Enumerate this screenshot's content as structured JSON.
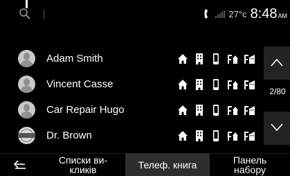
{
  "status": {
    "temperature": "27°c",
    "time": "8:48",
    "ampm": "AM"
  },
  "contacts": [
    {
      "name": "Adam Smith",
      "avatar": "person-icon"
    },
    {
      "name": "Vincent Casse",
      "avatar": "person-icon"
    },
    {
      "name": "Car Repair Hugo",
      "avatar": "person-icon"
    },
    {
      "name": "Dr. Brown",
      "avatar": "nissan-logo-icon"
    }
  ],
  "contact_type_icons": [
    "home-icon",
    "office-icon",
    "mobile-icon",
    "fax-home-icon",
    "fax-office-icon"
  ],
  "pagination": {
    "label": "2/80"
  },
  "tabs": {
    "history_label": "Списки ви-\nкликів",
    "phonebook_label": "Телеф. книга",
    "dialpad_label": "Панель\nнабору"
  }
}
